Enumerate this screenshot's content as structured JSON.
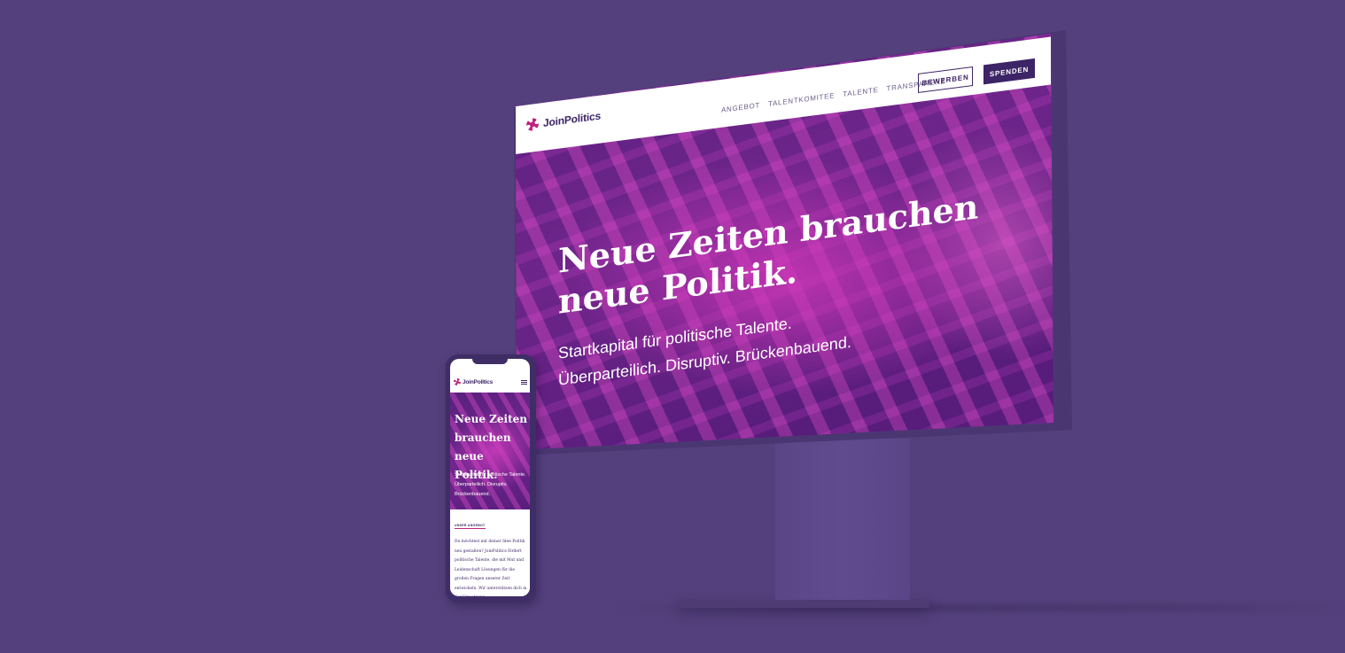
{
  "desktop": {
    "logo_text": "JoinPolitics",
    "nav": [
      "ANGEBOT",
      "TALENTKOMITEE",
      "TALENTE",
      "TRANSPARENZ"
    ],
    "apply_label": "BEWERBEN",
    "donate_label": "SPENDEN",
    "headline": "Neue Zeiten brauchen neue Politik.",
    "sub_line1": "Startkapital für politische Talente.",
    "sub_line2": "Überparteilich. Disruptiv. Brückenbauend."
  },
  "phone": {
    "logo_text": "JoinPolitics",
    "headline": "Neue Zeiten brauchen neue Politik.",
    "sub": "Startkapital für politische Talente. Überparteilich. Disruptiv. Brückenbauend.",
    "section_label": "UNSER ANGEBOT",
    "paragraph": "Du möchtest mit deiner Idee Politik neu gestalten? JoinPolitics fördert politische Talente, die mit Mut und Leidenschaft Lösungen für die großen Fragen unserer Zeit entwickeln. Wir unterstützen dich in der Umsetzung"
  },
  "colors": {
    "background": "#54407c",
    "brand_dark": "#3c2466",
    "brand_accent": "#c0237e",
    "hero_tint": "#7a2a96"
  },
  "icons": {
    "logo": "joinpolitics-flower-icon",
    "menu": "hamburger-menu-icon"
  }
}
